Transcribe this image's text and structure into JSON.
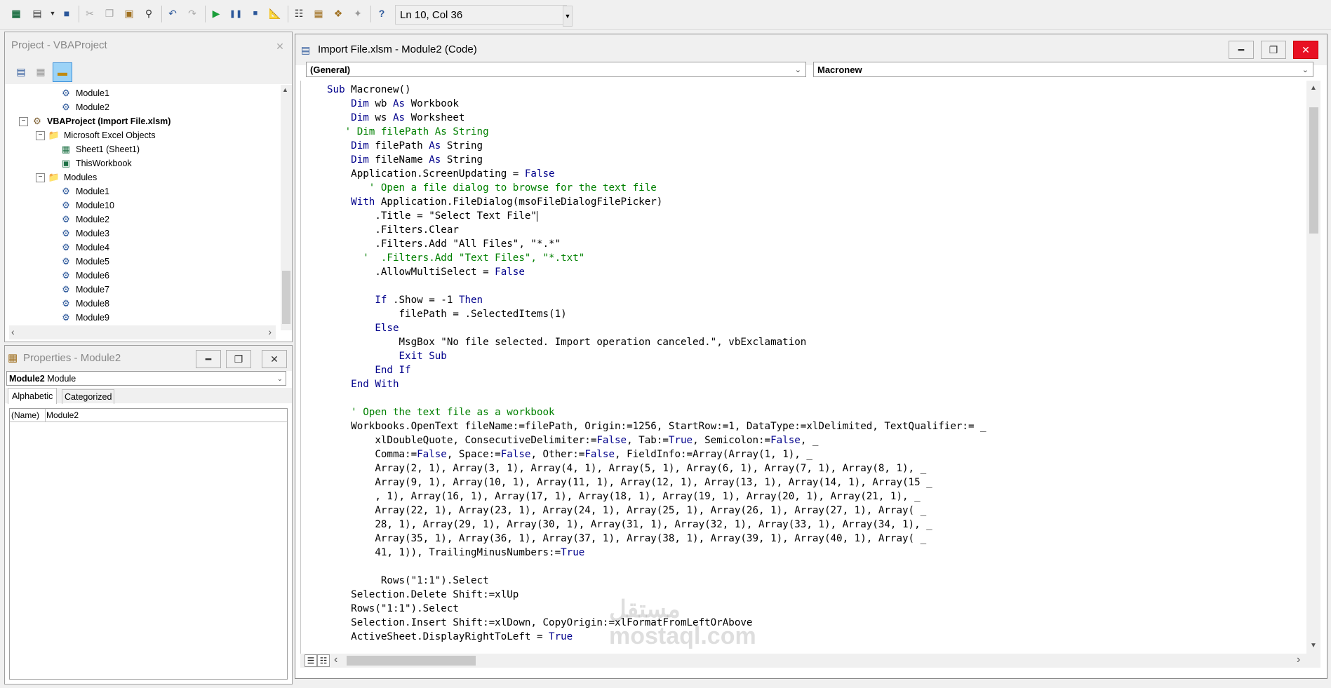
{
  "toolbar": {
    "status_text": "Ln 10, Col 36",
    "icons": [
      "excel-icon",
      "insert-userform-icon",
      "dropdown-arrow-icon",
      "save-icon",
      "cut-icon",
      "copy-icon",
      "paste-icon",
      "find-icon",
      "undo-icon",
      "redo-icon",
      "run-icon",
      "break-icon",
      "reset-icon",
      "design-mode-icon",
      "project-explorer-icon",
      "properties-window-icon",
      "object-browser-icon",
      "toolbox-icon",
      "help-icon"
    ]
  },
  "project": {
    "title": "Project - VBAProject",
    "tree": [
      {
        "label": "Module1",
        "icon": "module-icon",
        "level": 3,
        "bold": false
      },
      {
        "label": "Module2",
        "icon": "module-icon",
        "level": 3,
        "bold": false
      },
      {
        "label": "VBAProject (Import File.xlsm)",
        "icon": "vbaproject-icon",
        "level": 1,
        "bold": true,
        "expander": "−"
      },
      {
        "label": "Microsoft Excel Objects",
        "icon": "folder-icon",
        "level": 2,
        "bold": false,
        "expander": "−"
      },
      {
        "label": "Sheet1 (Sheet1)",
        "icon": "worksheet-icon",
        "level": 3,
        "bold": false
      },
      {
        "label": "ThisWorkbook",
        "icon": "workbook-icon",
        "level": 3,
        "bold": false
      },
      {
        "label": "Modules",
        "icon": "folder-icon",
        "level": 2,
        "bold": false,
        "expander": "−"
      },
      {
        "label": "Module1",
        "icon": "module-icon",
        "level": 3,
        "bold": false
      },
      {
        "label": "Module10",
        "icon": "module-icon",
        "level": 3,
        "bold": false
      },
      {
        "label": "Module2",
        "icon": "module-icon",
        "level": 3,
        "bold": false
      },
      {
        "label": "Module3",
        "icon": "module-icon",
        "level": 3,
        "bold": false
      },
      {
        "label": "Module4",
        "icon": "module-icon",
        "level": 3,
        "bold": false
      },
      {
        "label": "Module5",
        "icon": "module-icon",
        "level": 3,
        "bold": false
      },
      {
        "label": "Module6",
        "icon": "module-icon",
        "level": 3,
        "bold": false
      },
      {
        "label": "Module7",
        "icon": "module-icon",
        "level": 3,
        "bold": false
      },
      {
        "label": "Module8",
        "icon": "module-icon",
        "level": 3,
        "bold": false
      },
      {
        "label": "Module9",
        "icon": "module-icon",
        "level": 3,
        "bold": false
      }
    ]
  },
  "properties": {
    "title": "Properties - Module2",
    "object_name": "Module2",
    "object_type": "Module",
    "tab_alphabetic": "Alphabetic",
    "tab_categorized": "Categorized",
    "prop_name": "(Name)",
    "prop_value": "Module2"
  },
  "code_window": {
    "title": "Import File.xlsm - Module2 (Code)",
    "object_combo": "(General)",
    "procedure_combo": "Macronew",
    "lines": [
      [
        {
          "t": "Sub ",
          "c": "kw"
        },
        {
          "t": "Macronew()",
          "c": ""
        }
      ],
      [
        {
          "t": "    Dim ",
          "c": "kw"
        },
        {
          "t": "wb ",
          "c": ""
        },
        {
          "t": "As ",
          "c": "kw"
        },
        {
          "t": "Workbook",
          "c": ""
        }
      ],
      [
        {
          "t": "    Dim ",
          "c": "kw"
        },
        {
          "t": "ws ",
          "c": ""
        },
        {
          "t": "As ",
          "c": "kw"
        },
        {
          "t": "Worksheet",
          "c": ""
        }
      ],
      [
        {
          "t": "   ' Dim filePath As String",
          "c": "cm"
        }
      ],
      [
        {
          "t": "    Dim ",
          "c": "kw"
        },
        {
          "t": "filePath ",
          "c": ""
        },
        {
          "t": "As ",
          "c": "kw"
        },
        {
          "t": "String",
          "c": ""
        }
      ],
      [
        {
          "t": "    Dim ",
          "c": "kw"
        },
        {
          "t": "fileName ",
          "c": ""
        },
        {
          "t": "As ",
          "c": "kw"
        },
        {
          "t": "String",
          "c": ""
        }
      ],
      [
        {
          "t": "    Application.ScreenUpdating = ",
          "c": ""
        },
        {
          "t": "False",
          "c": "kw"
        }
      ],
      [
        {
          "t": "       ' Open a file dialog to browse for the text file",
          "c": "cm"
        }
      ],
      [
        {
          "t": "    With ",
          "c": "kw"
        },
        {
          "t": "Application.FileDialog(msoFileDialogFilePicker)",
          "c": ""
        }
      ],
      [
        {
          "t": "        .Title = \"Select Text File\"",
          "c": ""
        },
        {
          "t": "|cursor|",
          "c": "cursor"
        }
      ],
      [
        {
          "t": "        .Filters.Clear",
          "c": ""
        }
      ],
      [
        {
          "t": "        .Filters.Add \"All Files\", \"*.*\"",
          "c": ""
        }
      ],
      [
        {
          "t": "      '  .Filters.Add \"Text Files\", \"*.txt\"",
          "c": "cm"
        }
      ],
      [
        {
          "t": "        .AllowMultiSelect = ",
          "c": ""
        },
        {
          "t": "False",
          "c": "kw"
        }
      ],
      [
        {
          "t": "",
          "c": ""
        }
      ],
      [
        {
          "t": "        If ",
          "c": "kw"
        },
        {
          "t": ".Show = -1 ",
          "c": ""
        },
        {
          "t": "Then",
          "c": "kw"
        }
      ],
      [
        {
          "t": "            filePath = .SelectedItems(1)",
          "c": ""
        }
      ],
      [
        {
          "t": "        Else",
          "c": "kw"
        }
      ],
      [
        {
          "t": "            MsgBox \"No file selected. Import operation canceled.\", vbExclamation",
          "c": ""
        }
      ],
      [
        {
          "t": "            Exit Sub",
          "c": "kw"
        }
      ],
      [
        {
          "t": "        End If",
          "c": "kw"
        }
      ],
      [
        {
          "t": "    End With",
          "c": "kw"
        }
      ],
      [
        {
          "t": "",
          "c": ""
        }
      ],
      [
        {
          "t": "    ' Open the text file as a workbook",
          "c": "cm"
        }
      ],
      [
        {
          "t": "    Workbooks.OpenText fileName:=filePath, Origin:=1256, StartRow:=1, DataType:=xlDelimited, TextQualifier:= _",
          "c": ""
        }
      ],
      [
        {
          "t": "        xlDoubleQuote, ConsecutiveDelimiter:=",
          "c": ""
        },
        {
          "t": "False",
          "c": "kw"
        },
        {
          "t": ", Tab:=",
          "c": ""
        },
        {
          "t": "True",
          "c": "kw"
        },
        {
          "t": ", Semicolon:=",
          "c": ""
        },
        {
          "t": "False",
          "c": "kw"
        },
        {
          "t": ", _",
          "c": ""
        }
      ],
      [
        {
          "t": "        Comma:=",
          "c": ""
        },
        {
          "t": "False",
          "c": "kw"
        },
        {
          "t": ", Space:=",
          "c": ""
        },
        {
          "t": "False",
          "c": "kw"
        },
        {
          "t": ", Other:=",
          "c": ""
        },
        {
          "t": "False",
          "c": "kw"
        },
        {
          "t": ", FieldInfo:=Array(Array(1, 1), _",
          "c": ""
        }
      ],
      [
        {
          "t": "        Array(2, 1), Array(3, 1), Array(4, 1), Array(5, 1), Array(6, 1), Array(7, 1), Array(8, 1), _",
          "c": ""
        }
      ],
      [
        {
          "t": "        Array(9, 1), Array(10, 1), Array(11, 1), Array(12, 1), Array(13, 1), Array(14, 1), Array(15 _",
          "c": ""
        }
      ],
      [
        {
          "t": "        , 1), Array(16, 1), Array(17, 1), Array(18, 1), Array(19, 1), Array(20, 1), Array(21, 1), _",
          "c": ""
        }
      ],
      [
        {
          "t": "        Array(22, 1), Array(23, 1), Array(24, 1), Array(25, 1), Array(26, 1), Array(27, 1), Array( _",
          "c": ""
        }
      ],
      [
        {
          "t": "        28, 1), Array(29, 1), Array(30, 1), Array(31, 1), Array(32, 1), Array(33, 1), Array(34, 1), _",
          "c": ""
        }
      ],
      [
        {
          "t": "        Array(35, 1), Array(36, 1), Array(37, 1), Array(38, 1), Array(39, 1), Array(40, 1), Array( _",
          "c": ""
        }
      ],
      [
        {
          "t": "        41, 1)), TrailingMinusNumbers:=",
          "c": ""
        },
        {
          "t": "True",
          "c": "kw"
        }
      ],
      [
        {
          "t": "",
          "c": ""
        }
      ],
      [
        {
          "t": "         Rows(\"1:1\").Select",
          "c": ""
        }
      ],
      [
        {
          "t": "    Selection.Delete Shift:=xlUp",
          "c": ""
        }
      ],
      [
        {
          "t": "    Rows(\"1:1\").Select",
          "c": ""
        }
      ],
      [
        {
          "t": "    Selection.Insert Shift:=xlDown, CopyOrigin:=xlFormatFromLeftOrAbove",
          "c": ""
        }
      ],
      [
        {
          "t": "    ActiveSheet.DisplayRightToLeft = ",
          "c": ""
        },
        {
          "t": "True",
          "c": "kw"
        }
      ]
    ]
  },
  "watermark": {
    "arabic": "مستقل",
    "latin": "mostaql.com"
  }
}
